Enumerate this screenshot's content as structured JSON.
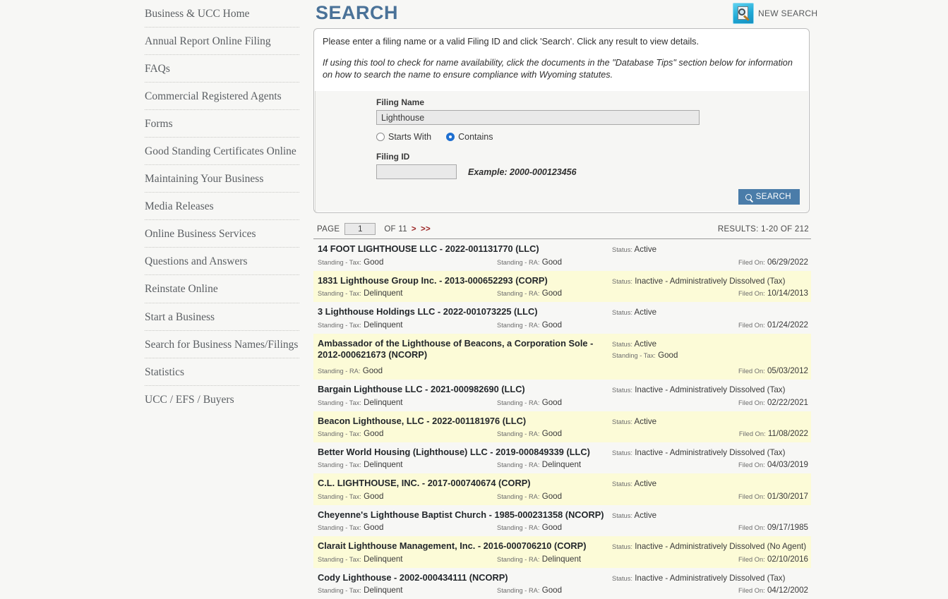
{
  "sidebar": {
    "items": [
      {
        "label": "Business & UCC Home"
      },
      {
        "label": "Annual Report Online Filing"
      },
      {
        "label": "FAQs"
      },
      {
        "label": "Commercial Registered Agents"
      },
      {
        "label": "Forms"
      },
      {
        "label": "Good Standing Certificates Online"
      },
      {
        "label": "Maintaining Your Business"
      },
      {
        "label": "Media Releases"
      },
      {
        "label": "Online Business Services"
      },
      {
        "label": "Questions and Answers"
      },
      {
        "label": "Reinstate Online"
      },
      {
        "label": "Start a Business"
      },
      {
        "label": "Search for Business Names/Filings"
      },
      {
        "label": "Statistics"
      },
      {
        "label": "UCC / EFS / Buyers"
      }
    ]
  },
  "header": {
    "title": "SEARCH",
    "new_search_label": "NEW SEARCH",
    "new_search_icon": "new-search-magnifier-icon"
  },
  "panel": {
    "intro_line_1": "Please enter a filing name or a valid Filing ID and click 'Search'. Click any result to view details.",
    "intro_line_2": "If using this tool to check for name availability, click the documents in the \"Database Tips\" section below for information on how to search the name to ensure compliance with Wyoming statutes.",
    "filing_name_label": "Filing Name",
    "filing_name_value": "Lighthouse",
    "filing_name_placeholder": "",
    "radio_starts_with": "Starts With",
    "radio_contains": "Contains",
    "selected_match_mode": "Contains",
    "filing_id_label": "Filing ID",
    "filing_id_value": "",
    "filing_id_placeholder": "",
    "example_text": "Example: 2000-000123456",
    "search_button_label": "SEARCH",
    "search_button_icon": "magnifier-icon"
  },
  "pagination": {
    "page_word": "PAGE",
    "page_value": "1",
    "of_text": "OF 11",
    "next_link": ">",
    "last_link": ">>",
    "results_count": "RESULTS: 1-20 OF 212"
  },
  "results": {
    "labels": {
      "status": "Status:",
      "standing_tax": "Standing - Tax:",
      "standing_ra": "Standing - RA:",
      "filed_on": "Filed On:"
    },
    "rows": [
      {
        "title": "14 FOOT LIGHTHOUSE LLC - 2022-001131770 (LLC)",
        "status": "Active",
        "standing_tax": "Good",
        "standing_ra": "Good",
        "filed_on": "06/29/2022",
        "highlight": false,
        "stacked": false
      },
      {
        "title": "1831 Lighthouse Group Inc. - 2013-000652293 (CORP)",
        "status": "Inactive - Administratively Dissolved (Tax)",
        "standing_tax": "Delinquent",
        "standing_ra": "Good",
        "filed_on": "10/14/2013",
        "highlight": true,
        "stacked": false
      },
      {
        "title": "3 Lighthouse Holdings LLC - 2022-001073225 (LLC)",
        "status": "Active",
        "standing_tax": "Delinquent",
        "standing_ra": "Good",
        "filed_on": "01/24/2022",
        "highlight": false,
        "stacked": false
      },
      {
        "title": "Ambassador of the Lighthouse of Beacons, a Corporation Sole - 2012-000621673 (NCORP)",
        "status": "Active",
        "standing_tax": "Good",
        "standing_ra": "Good",
        "filed_on": "05/03/2012",
        "highlight": true,
        "stacked": true
      },
      {
        "title": "Bargain Lighthouse LLC - 2021-000982690 (LLC)",
        "status": "Inactive - Administratively Dissolved (Tax)",
        "standing_tax": "Delinquent",
        "standing_ra": "Good",
        "filed_on": "02/22/2021",
        "highlight": false,
        "stacked": false
      },
      {
        "title": "Beacon Lighthouse, LLC - 2022-001181976 (LLC)",
        "status": "Active",
        "standing_tax": "Good",
        "standing_ra": "Good",
        "filed_on": "11/08/2022",
        "highlight": true,
        "stacked": false
      },
      {
        "title": "Better World Housing (Lighthouse) LLC - 2019-000849339 (LLC)",
        "status": "Inactive - Administratively Dissolved (Tax)",
        "standing_tax": "Delinquent",
        "standing_ra": "Delinquent",
        "filed_on": "04/03/2019",
        "highlight": false,
        "stacked": false
      },
      {
        "title": "C.L. LIGHTHOUSE, INC. - 2017-000740674 (CORP)",
        "status": "Active",
        "standing_tax": "Good",
        "standing_ra": "Good",
        "filed_on": "01/30/2017",
        "highlight": true,
        "stacked": false
      },
      {
        "title": "Cheyenne's Lighthouse Baptist Church - 1985-000231358 (NCORP)",
        "status": "Active",
        "standing_tax": "Good",
        "standing_ra": "Good",
        "filed_on": "09/17/1985",
        "highlight": false,
        "stacked": false
      },
      {
        "title": "Clarait Lighthouse Management, Inc. - 2016-000706210 (CORP)",
        "status": "Inactive - Administratively Dissolved (No Agent)",
        "standing_tax": "Delinquent",
        "standing_ra": "Delinquent",
        "filed_on": "02/10/2016",
        "highlight": true,
        "stacked": false
      },
      {
        "title": "Cody Lighthouse - 2002-000434111 (NCORP)",
        "status": "Inactive - Administratively Dissolved (Tax)",
        "standing_tax": "Delinquent",
        "standing_ra": "Good",
        "filed_on": "04/12/2002",
        "highlight": false,
        "stacked": false
      }
    ]
  },
  "colors": {
    "title_blue": "#4a7298",
    "button_blue": "#4a7ca9",
    "highlight_yellow": "#fcfbd7",
    "pager_link_red": "#9e2b2b",
    "page_background": "#f7f7f5"
  }
}
